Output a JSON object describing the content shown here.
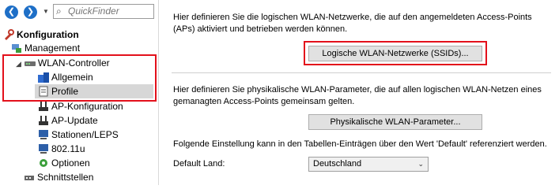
{
  "toolbar": {
    "search_placeholder": "QuickFinder"
  },
  "tree": {
    "root": "Konfiguration",
    "items": [
      {
        "label": "Management"
      },
      {
        "label": "WLAN-Controller"
      },
      {
        "label": "Allgemein"
      },
      {
        "label": "Profile"
      },
      {
        "label": "AP-Konfiguration"
      },
      {
        "label": "AP-Update"
      },
      {
        "label": "Stationen/LEPS"
      },
      {
        "label": "802.11u"
      },
      {
        "label": "Optionen"
      },
      {
        "label": "Schnittstellen"
      }
    ]
  },
  "section1": {
    "text": "Hier definieren Sie die logischen WLAN-Netzwerke, die auf den angemeldeten Access-Points (APs) aktiviert und betrieben werden können.",
    "button": "Logische WLAN-Netzwerke (SSIDs)..."
  },
  "section2": {
    "text": "Hier definieren Sie physikalische WLAN-Parameter, die auf allen logischen WLAN-Netzen eines gemanagten Access-Points gemeinsam gelten.",
    "button": "Physikalische WLAN-Parameter..."
  },
  "section3": {
    "text": "Folgende Einstellung kann in den Tabellen-Einträgen über den Wert 'Default' referenziert werden.",
    "label": "Default Land:",
    "value": "Deutschland"
  },
  "colors": {
    "highlight": "#e3101b",
    "selection": "#d7d7d7",
    "nav": "#1e6fc7"
  }
}
